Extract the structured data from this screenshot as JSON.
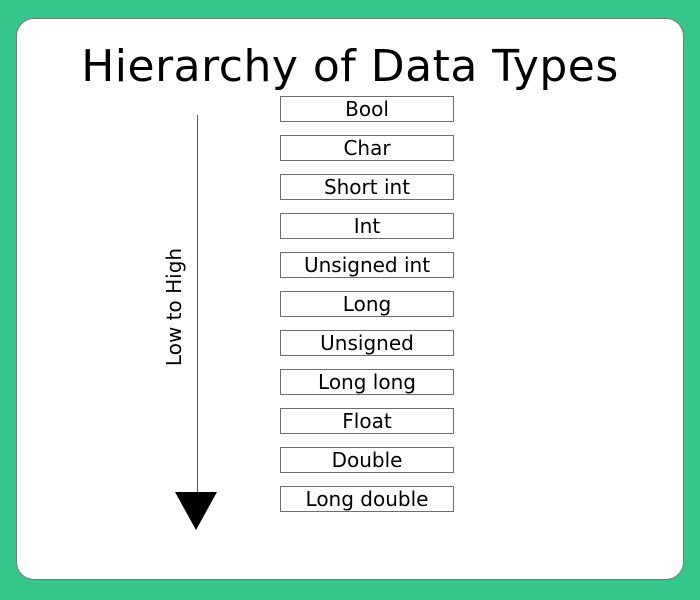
{
  "title": "Hierarchy of Data Types",
  "axis_label": "Low to High",
  "arrow_icon": "arrow-down-icon",
  "colors": {
    "background": "#35c78a",
    "card": "#ffffff",
    "text": "#000000",
    "border": "#6e6e6e"
  },
  "types": [
    {
      "label": "Bool"
    },
    {
      "label": "Char"
    },
    {
      "label": "Short int"
    },
    {
      "label": "Int"
    },
    {
      "label": "Unsigned int"
    },
    {
      "label": "Long"
    },
    {
      "label": "Unsigned"
    },
    {
      "label": "Long long"
    },
    {
      "label": "Float"
    },
    {
      "label": "Double"
    },
    {
      "label": "Long double"
    }
  ]
}
